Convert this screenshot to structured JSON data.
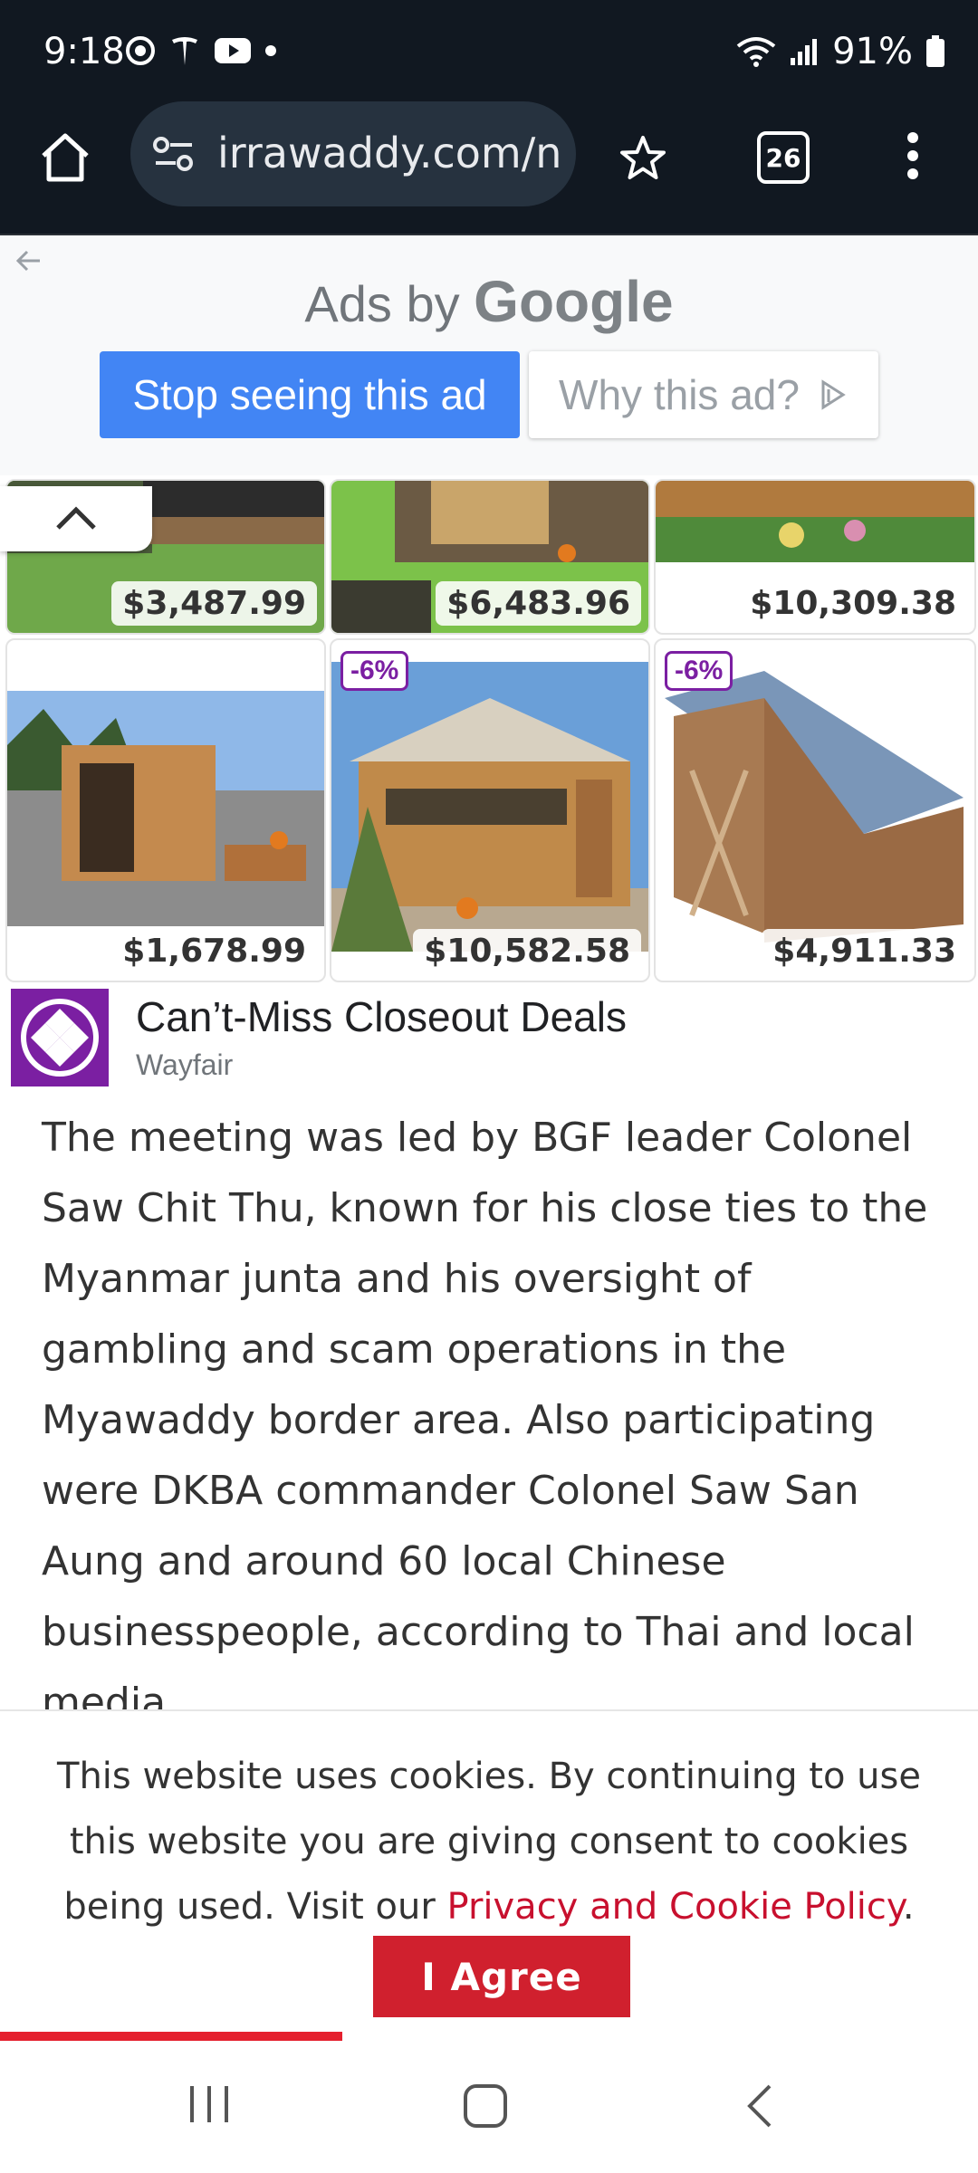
{
  "status_bar": {
    "time": "9:18",
    "battery": "91%",
    "icons": [
      "target-icon",
      "tesla-icon",
      "youtube-icon",
      "dot-icon",
      "wifi-icon",
      "signal-icon",
      "battery-icon"
    ]
  },
  "browser": {
    "url": "irrawaddy.com/ne",
    "tab_count": "26",
    "icons": [
      "home-icon",
      "site-settings-icon",
      "star-icon",
      "tabs-icon",
      "more-icon"
    ]
  },
  "ad_header": {
    "ads_by": "Ads by",
    "brand": "Google",
    "stop_label": "Stop seeing this ad",
    "why_label": "Why this ad?"
  },
  "products": [
    {
      "price": "$3,487.99",
      "discount": ""
    },
    {
      "price": "$6,483.96",
      "discount": ""
    },
    {
      "price": "$10,309.38",
      "discount": ""
    },
    {
      "price": "$1,678.99",
      "discount": ""
    },
    {
      "price": "$10,582.58",
      "discount": "-6%"
    },
    {
      "price": "$4,911.33",
      "discount": "-6%"
    }
  ],
  "advertiser": {
    "title": "Can’t-Miss Closeout Deals",
    "name": "Wayfair",
    "accent": "#7b1fa2"
  },
  "article": {
    "paragraph": "The meeting was led by BGF leader Colonel Saw Chit Thu, known for his close ties to the Myanmar junta and his oversight of gambling and scam operations in the Myawaddy border area. Also participating were DKBA commander Colonel Saw San Aung and around 60 local Chinese businesspeople, according to Thai and local media."
  },
  "cookie": {
    "text": "This website uses cookies. By continuing to use this website you are giving consent to cookies being used. Visit our ",
    "link": "Privacy and Cookie Policy",
    "after": ".",
    "agree_label": "I Agree",
    "progress": 0.35,
    "accent": "#d0202e"
  },
  "nav_bar": {
    "icons": [
      "recents-icon",
      "home-button-icon",
      "back-icon"
    ]
  }
}
